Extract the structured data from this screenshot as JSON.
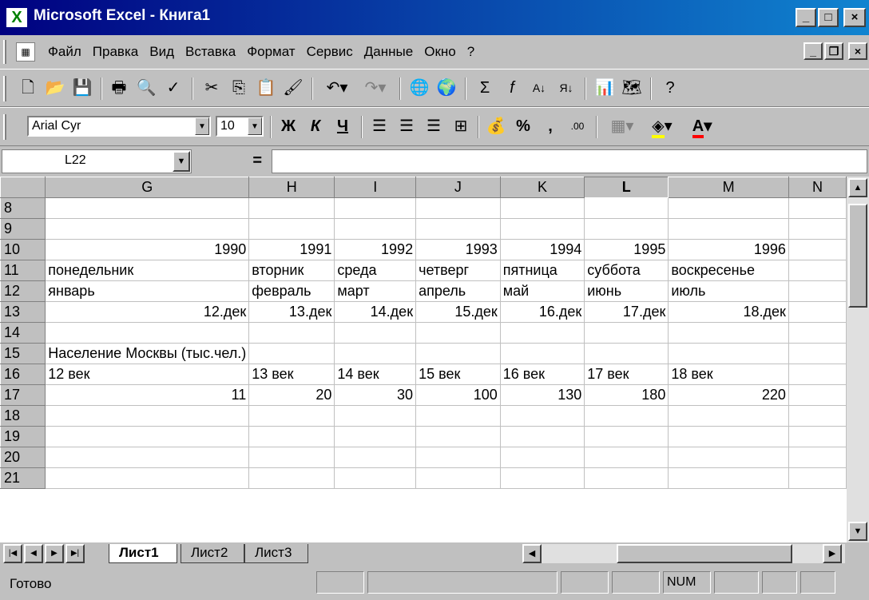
{
  "window": {
    "title": "Microsoft Excel - Книга1",
    "minimize": "_",
    "maximize": "□",
    "close": "×"
  },
  "menu": {
    "items": [
      "Файл",
      "Правка",
      "Вид",
      "Вставка",
      "Формат",
      "Сервис",
      "Данные",
      "Окно",
      "?"
    ]
  },
  "format_toolbar": {
    "font": "Arial Cyr",
    "size": "10",
    "bold": "Ж",
    "italic": "К",
    "underline": "Ч",
    "percent": "%",
    "comma": ","
  },
  "formula_bar": {
    "cell_ref": "L22",
    "equals": "="
  },
  "grid": {
    "columns": [
      "G",
      "H",
      "I",
      "J",
      "K",
      "L",
      "M",
      "N"
    ],
    "selected_column": "L",
    "rows": [
      {
        "n": "8",
        "cells": [
          "",
          "",
          "",
          "",
          "",
          "",
          "",
          ""
        ]
      },
      {
        "n": "9",
        "cells": [
          "",
          "",
          "",
          "",
          "",
          "",
          "",
          ""
        ]
      },
      {
        "n": "10",
        "cells": [
          "1990",
          "1991",
          "1992",
          "1993",
          "1994",
          "1995",
          "1996",
          ""
        ]
      },
      {
        "n": "11",
        "cells": [
          "понедельник",
          "вторник",
          "среда",
          "четверг",
          "пятница",
          "суббота",
          "воскресенье",
          ""
        ]
      },
      {
        "n": "12",
        "cells": [
          "январь",
          "февраль",
          "март",
          "апрель",
          "май",
          "июнь",
          "июль",
          ""
        ]
      },
      {
        "n": "13",
        "cells": [
          "12.дек",
          "13.дек",
          "14.дек",
          "15.дек",
          "16.дек",
          "17.дек",
          "18.дек",
          ""
        ]
      },
      {
        "n": "14",
        "cells": [
          "",
          "",
          "",
          "",
          "",
          "",
          "",
          ""
        ]
      },
      {
        "n": "15",
        "cells": [
          "Население Москвы (тыс.чел.)",
          "",
          "",
          "",
          "",
          "",
          "",
          ""
        ]
      },
      {
        "n": "16",
        "cells": [
          "12 век",
          "13 век",
          "14 век",
          "15 век",
          "16 век",
          "17 век",
          "18 век",
          ""
        ]
      },
      {
        "n": "17",
        "cells": [
          "11",
          "20",
          "30",
          "100",
          "130",
          "180",
          "220",
          ""
        ]
      },
      {
        "n": "18",
        "cells": [
          "",
          "",
          "",
          "",
          "",
          "",
          "",
          ""
        ]
      },
      {
        "n": "19",
        "cells": [
          "",
          "",
          "",
          "",
          "",
          "",
          "",
          ""
        ]
      },
      {
        "n": "20",
        "cells": [
          "",
          "",
          "",
          "",
          "",
          "",
          "",
          ""
        ]
      },
      {
        "n": "21",
        "cells": [
          "",
          "",
          "",
          "",
          "",
          "",
          "",
          ""
        ]
      }
    ],
    "right_aligned_rows": [
      "10",
      "13",
      "17"
    ]
  },
  "sheets": {
    "tabs": [
      "Лист1",
      "Лист2",
      "Лист3"
    ],
    "active": "Лист1"
  },
  "status": {
    "text": "Готово",
    "num": "NUM"
  },
  "colors": {
    "title_start": "#000080",
    "title_end": "#1084d0",
    "face": "#c0c0c0"
  }
}
